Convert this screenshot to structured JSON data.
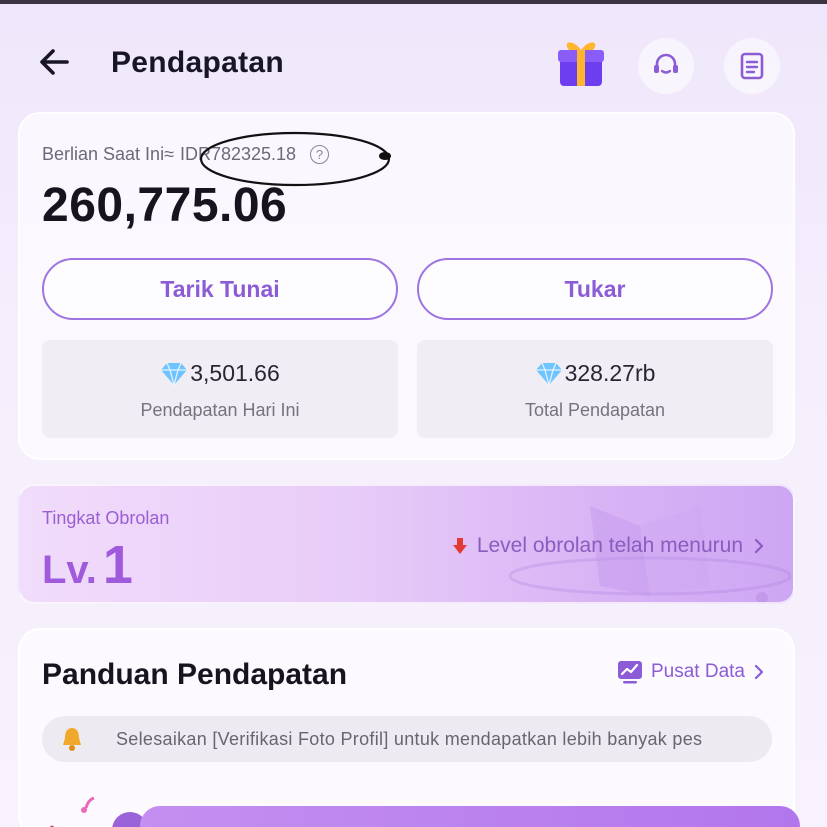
{
  "header": {
    "title": "Pendapatan",
    "icons": [
      "back-arrow-icon",
      "gift-icon",
      "customer-service-icon",
      "document-icon"
    ]
  },
  "balance": {
    "label": "Berlian Saat Ini≈",
    "idr_value": "IDR782325.18",
    "value": "260,775.06",
    "withdraw_label": "Tarik Tunai",
    "exchange_label": "Tukar",
    "today": {
      "value": "3,501.66",
      "label": "Pendapatan Hari Ini"
    },
    "total": {
      "value": "328.27rb",
      "label": "Total Pendapatan"
    }
  },
  "level": {
    "label": "Tingkat Obrolan",
    "prefix": "Lv.",
    "number": "1",
    "status": "Level obrolan telah menurun"
  },
  "guide": {
    "title": "Panduan Pendapatan",
    "data_link": "Pusat Data",
    "notice": "Selesaikan [Verifikasi Foto Profil] untuk mendapatkan lebih banyak pes"
  },
  "colors": {
    "accent": "#8b5cd6",
    "level_accent": "#a05bdc",
    "down_arrow": "#e53935"
  }
}
